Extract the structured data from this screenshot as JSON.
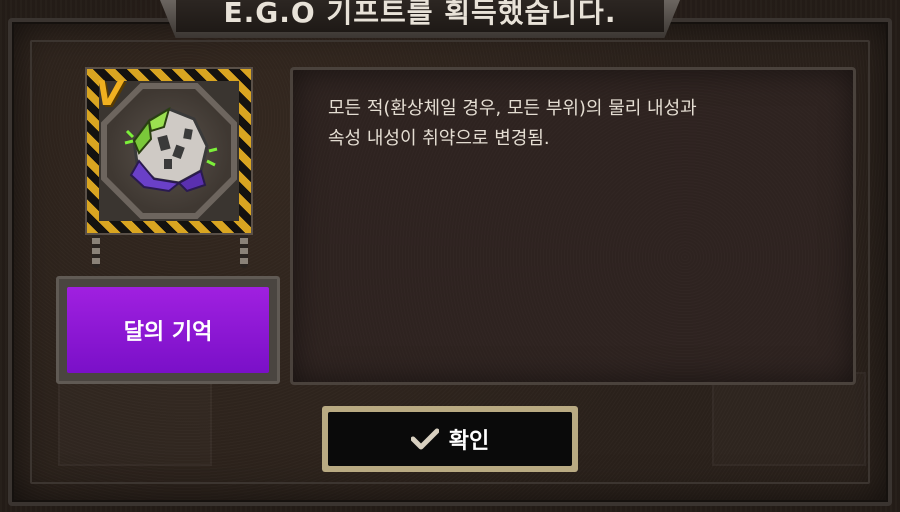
{
  "dialog": {
    "title": "E.G.O 기프트를 획득했습니다."
  },
  "gift": {
    "grade": "V",
    "name": "달의 기억",
    "icon": "moon-memory-gift-icon",
    "description_lines": [
      "모든 적(환상체일 경우, 모든 부위)의 물리 내성과",
      "속성 내성이 취약으로 변경됨."
    ]
  },
  "buttons": {
    "confirm_label": "확인",
    "confirm_icon": "checkmark-icon"
  },
  "colors": {
    "name_plate": "#9a1ee0",
    "grade_badge": "#f0b020",
    "hazard_stripe": "#d9a521",
    "confirm_border": "#b9aa82"
  }
}
